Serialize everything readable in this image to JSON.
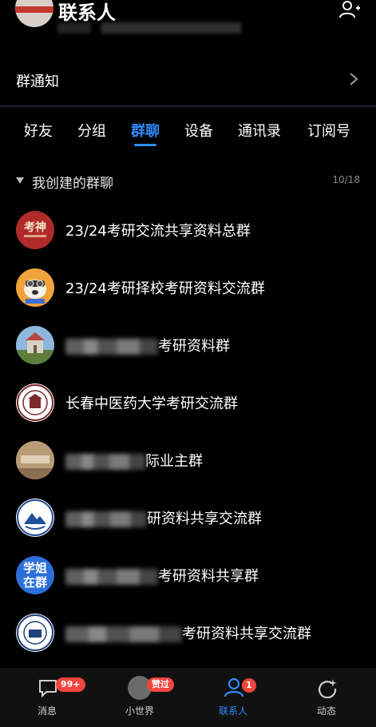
{
  "header": {
    "title": "联系人"
  },
  "notice": {
    "label": "群通知"
  },
  "tabs": [
    "好友",
    "分组",
    "群聊",
    "设备",
    "通讯录",
    "订阅号"
  ],
  "section": {
    "title": "我创建的群聊",
    "count": "10/18"
  },
  "groups": [
    {
      "avatar_text": "考神",
      "name_visible": "23/24考研交流共享资料总群"
    },
    {
      "name_visible": "23/24考研择校考研资料交流群"
    },
    {
      "name_suffix": "考研资料群"
    },
    {
      "name_visible": "长春中医药大学考研交流群"
    },
    {
      "name_suffix": "际业主群"
    },
    {
      "name_suffix": "研资料共享交流群"
    },
    {
      "avatar_text": "学姐在群",
      "name_suffix": "考研资料共享群"
    },
    {
      "name_suffix": "考研资料共享交流群"
    }
  ],
  "bottom_nav": [
    {
      "label": "消息",
      "badge": "99+"
    },
    {
      "label": "小世界",
      "badge": "赞过"
    },
    {
      "label": "联系人",
      "badge": "1"
    },
    {
      "label": "动态"
    }
  ],
  "colors": {
    "accent": "#2f8cff",
    "badge": "#f2453d",
    "background": "#000000"
  }
}
